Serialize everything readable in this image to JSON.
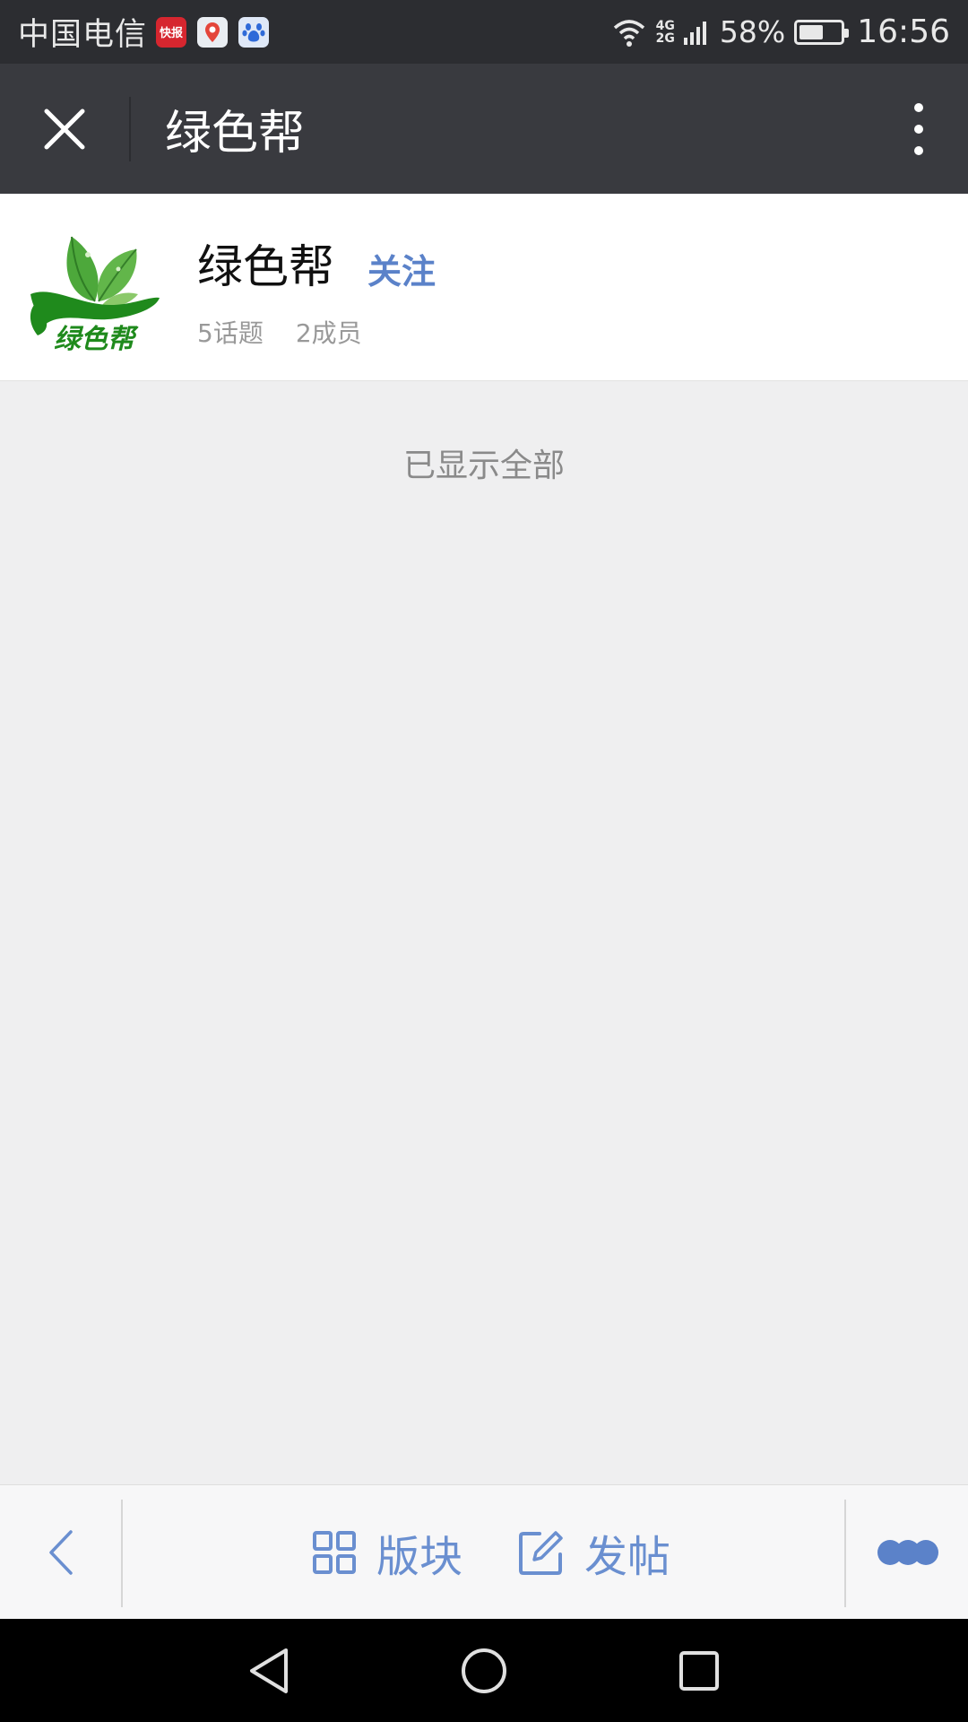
{
  "status_bar": {
    "carrier": "中国电信",
    "app_icons": [
      {
        "name": "news-app-icon",
        "label": "快报"
      },
      {
        "name": "map-app-icon",
        "label": ""
      },
      {
        "name": "baidu-app-icon",
        "label": ""
      }
    ],
    "network_top": "4G",
    "network_bottom": "2G",
    "battery_percent": "58%",
    "battery_level": 0.58,
    "time": "16:56"
  },
  "title_bar": {
    "title": "绿色帮",
    "close_icon": "close-icon",
    "menu_icon": "more-vertical-icon"
  },
  "group": {
    "logo_text": "绿色帮",
    "name": "绿色帮",
    "follow_label": "关注",
    "topics": "5话题",
    "members": "2成员"
  },
  "content": {
    "end_text": "已显示全部"
  },
  "toolbar": {
    "back_icon": "chevron-left-icon",
    "boards_label": "版块",
    "post_label": "发帖",
    "more_icon": "more-dots-icon"
  },
  "colors": {
    "accent": "#5b82c9",
    "title_bar": "#393a3f",
    "status_bar": "#2c2d31",
    "page_bg": "#efeff0",
    "logo_green": "#1f8a1c"
  }
}
